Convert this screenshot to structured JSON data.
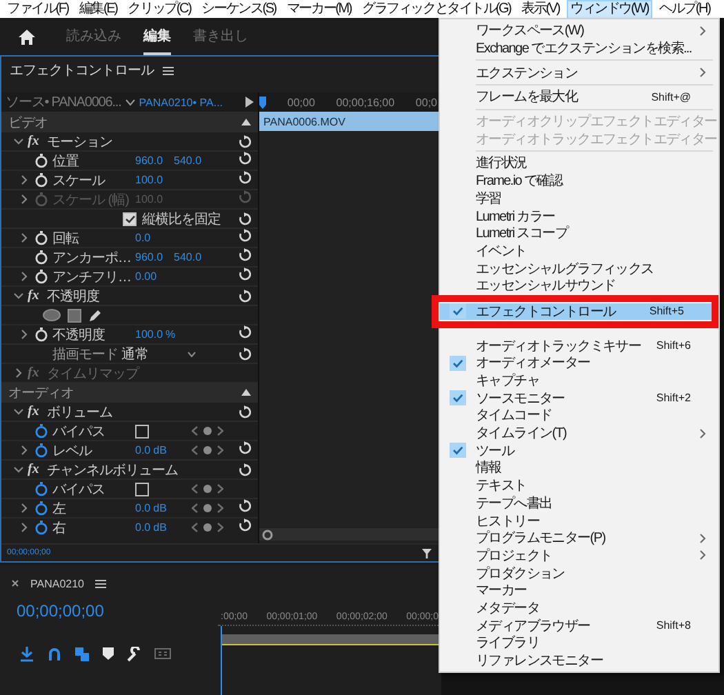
{
  "menu_bar": [
    {
      "label": "ファイル(F)",
      "selected": false
    },
    {
      "label": "編集(E)",
      "selected": false
    },
    {
      "label": "クリップ(C)",
      "selected": false
    },
    {
      "label": "シーケンス(S)",
      "selected": false
    },
    {
      "label": "マーカー(M)",
      "selected": false
    },
    {
      "label": "グラフィックとタイトル(G)",
      "selected": false
    },
    {
      "label": "表示(V)",
      "selected": false
    },
    {
      "label": "ウィンドウ(W)",
      "selected": true
    },
    {
      "label": "ヘルプ(H)",
      "selected": false
    }
  ],
  "workspace_tabs": [
    {
      "label": "読み込み",
      "selected": false
    },
    {
      "label": "編集",
      "selected": true
    },
    {
      "label": "書き出し",
      "selected": false
    }
  ],
  "effect_controls": {
    "title": "エフェクトコントロール",
    "source": "ソース• PANA0006...",
    "sequence": "PANA0210• PA...",
    "ruler": [
      "00;00",
      "00;00;16;00",
      "00;0"
    ],
    "clip": "PANA0006.MOV",
    "timecode": "00;00;00;00",
    "rows": [
      {
        "kind": "section",
        "label": "ビデオ"
      },
      {
        "kind": "effect",
        "badge": "fx",
        "label": "モーション",
        "expanded": true,
        "reset": true
      },
      {
        "kind": "param",
        "label": "位置",
        "values": [
          "960.0",
          "540.0"
        ],
        "expandable": false,
        "disabled": false,
        "animated": false,
        "keyframe_nav": false,
        "reset": true
      },
      {
        "kind": "param",
        "label": "スケール",
        "values": [
          "100.0"
        ],
        "expandable": true,
        "disabled": false,
        "animated": false,
        "keyframe_nav": false,
        "reset": true
      },
      {
        "kind": "param",
        "label": "スケール (幅)",
        "values": [
          "100.0"
        ],
        "expandable": true,
        "disabled": true,
        "animated": false,
        "keyframe_nav": false,
        "reset": true
      },
      {
        "kind": "option",
        "label": "縦横比を固定",
        "checked": true,
        "reset": true
      },
      {
        "kind": "param",
        "label": "回転",
        "values": [
          "0.0"
        ],
        "expandable": true,
        "disabled": false,
        "animated": false,
        "keyframe_nav": false,
        "reset": true
      },
      {
        "kind": "param",
        "label": "アンカーポ…",
        "values": [
          "960.0",
          "540.0"
        ],
        "expandable": false,
        "disabled": false,
        "animated": false,
        "keyframe_nav": false,
        "reset": true
      },
      {
        "kind": "param",
        "label": "アンチフリ…",
        "values": [
          "0.00"
        ],
        "expandable": true,
        "disabled": false,
        "animated": false,
        "keyframe_nav": false,
        "reset": true
      },
      {
        "kind": "effect",
        "badge": "fx",
        "label": "不透明度",
        "expanded": true,
        "reset": true
      },
      {
        "kind": "masks"
      },
      {
        "kind": "param",
        "label": "不透明度",
        "values": [
          "100.0"
        ],
        "unit": "%",
        "expandable": true,
        "disabled": false,
        "animated": false,
        "keyframe_nav": false,
        "reset": true
      },
      {
        "kind": "dropdown",
        "label": "描画モード",
        "value": "通常",
        "reset": true
      },
      {
        "kind": "effect",
        "badge": "fx",
        "label": "タイムリマップ",
        "expanded": false,
        "reset": false
      },
      {
        "kind": "section",
        "label": "オーディオ"
      },
      {
        "kind": "effect",
        "badge": "fx",
        "label": "ボリューム",
        "expanded": true,
        "reset": true
      },
      {
        "kind": "toggle",
        "label": "バイパス",
        "checked": false,
        "animated": true,
        "keyframe_nav": true
      },
      {
        "kind": "param",
        "label": "レベル",
        "values": [
          "0.0"
        ],
        "unit": "dB",
        "expandable": true,
        "disabled": false,
        "animated": true,
        "keyframe_nav": true,
        "reset": true
      },
      {
        "kind": "effect",
        "badge": "fx",
        "label": "チャンネルボリューム",
        "expanded": true,
        "reset": true
      },
      {
        "kind": "toggle",
        "label": "バイパス",
        "checked": false,
        "animated": true,
        "keyframe_nav": true
      },
      {
        "kind": "param",
        "label": "左",
        "values": [
          "0.0"
        ],
        "unit": "dB",
        "expandable": true,
        "disabled": false,
        "animated": true,
        "keyframe_nav": true,
        "reset": true
      },
      {
        "kind": "param",
        "label": "右",
        "values": [
          "0.0"
        ],
        "unit": "dB",
        "expandable": true,
        "disabled": false,
        "animated": true,
        "keyframe_nav": true,
        "reset": true
      }
    ]
  },
  "timeline": {
    "title": "PANA0210",
    "timecode": "00;00;00;00",
    "ruler": [
      ":00;00",
      "00;00;01;00",
      "00;00;02;00",
      "00;00;0"
    ]
  },
  "window_menu": [
    {
      "kind": "item",
      "label": "ワークスペース(W)",
      "submenu": true,
      "checked": false,
      "disabled": false,
      "selected": false,
      "framed": false
    },
    {
      "kind": "item",
      "label": "Exchange でエクステンションを検索...",
      "submenu": false,
      "checked": false,
      "disabled": false,
      "selected": false,
      "framed": false
    },
    {
      "kind": "separator"
    },
    {
      "kind": "item",
      "label": "エクステンション",
      "submenu": true,
      "checked": false,
      "disabled": false,
      "selected": false,
      "framed": false
    },
    {
      "kind": "separator"
    },
    {
      "kind": "item",
      "label": "フレームを最大化",
      "shortcut": "Shift+@",
      "submenu": false,
      "checked": false,
      "disabled": false,
      "selected": false,
      "framed": false
    },
    {
      "kind": "separator"
    },
    {
      "kind": "item",
      "label": "オーディオクリップエフェクトエディター",
      "submenu": false,
      "checked": false,
      "disabled": true,
      "selected": false,
      "framed": false
    },
    {
      "kind": "item",
      "label": "オーディオトラックエフェクトエディター",
      "submenu": false,
      "checked": false,
      "disabled": true,
      "selected": false,
      "framed": false
    },
    {
      "kind": "separator"
    },
    {
      "kind": "item",
      "label": "進行状況",
      "submenu": false,
      "checked": false,
      "disabled": false,
      "selected": false,
      "framed": false
    },
    {
      "kind": "item",
      "label": "Frame.io で確認",
      "submenu": false,
      "checked": false,
      "disabled": false,
      "selected": false,
      "framed": false
    },
    {
      "kind": "item",
      "label": "学習",
      "submenu": false,
      "checked": false,
      "disabled": false,
      "selected": false,
      "framed": false
    },
    {
      "kind": "item",
      "label": "Lumetri カラー",
      "submenu": false,
      "checked": false,
      "disabled": false,
      "selected": false,
      "framed": false
    },
    {
      "kind": "item",
      "label": "Lumetri スコープ",
      "submenu": false,
      "checked": false,
      "disabled": false,
      "selected": false,
      "framed": false
    },
    {
      "kind": "item",
      "label": "イベント",
      "submenu": false,
      "checked": false,
      "disabled": false,
      "selected": false,
      "framed": false
    },
    {
      "kind": "item",
      "label": "エッセンシャルグラフィックス",
      "submenu": false,
      "checked": false,
      "disabled": false,
      "selected": false,
      "framed": false
    },
    {
      "kind": "item",
      "label": "エッセンシャルサウンド",
      "submenu": false,
      "checked": false,
      "disabled": false,
      "selected": false,
      "framed": false
    },
    {
      "kind": "item",
      "label": "エフェクトコントロール",
      "shortcut": "Shift+5",
      "submenu": false,
      "checked": true,
      "disabled": false,
      "selected": true,
      "framed": true
    },
    {
      "kind": "item",
      "label": "オーディオトラックミキサー",
      "shortcut": "Shift+6",
      "submenu": false,
      "checked": false,
      "disabled": false,
      "selected": false,
      "framed": false
    },
    {
      "kind": "item",
      "label": "オーディオメーター",
      "submenu": false,
      "checked": true,
      "disabled": false,
      "selected": false,
      "framed": false
    },
    {
      "kind": "item",
      "label": "キャプチャ",
      "submenu": false,
      "checked": false,
      "disabled": false,
      "selected": false,
      "framed": false
    },
    {
      "kind": "item",
      "label": "ソースモニター",
      "shortcut": "Shift+2",
      "submenu": false,
      "checked": true,
      "disabled": false,
      "selected": false,
      "framed": false
    },
    {
      "kind": "item",
      "label": "タイムコード",
      "submenu": false,
      "checked": false,
      "disabled": false,
      "selected": false,
      "framed": false
    },
    {
      "kind": "item",
      "label": "タイムライン(T)",
      "submenu": true,
      "checked": false,
      "disabled": false,
      "selected": false,
      "framed": false
    },
    {
      "kind": "item",
      "label": "ツール",
      "submenu": false,
      "checked": true,
      "disabled": false,
      "selected": false,
      "framed": false
    },
    {
      "kind": "item",
      "label": "情報",
      "submenu": false,
      "checked": false,
      "disabled": false,
      "selected": false,
      "framed": false
    },
    {
      "kind": "item",
      "label": "テキスト",
      "submenu": false,
      "checked": false,
      "disabled": false,
      "selected": false,
      "framed": false
    },
    {
      "kind": "item",
      "label": "テープへ書出",
      "submenu": false,
      "checked": false,
      "disabled": false,
      "selected": false,
      "framed": false
    },
    {
      "kind": "item",
      "label": "ヒストリー",
      "submenu": false,
      "checked": false,
      "disabled": false,
      "selected": false,
      "framed": false
    },
    {
      "kind": "item",
      "label": "プログラムモニター(P)",
      "submenu": true,
      "checked": false,
      "disabled": false,
      "selected": false,
      "framed": false
    },
    {
      "kind": "item",
      "label": "プロジェクト",
      "submenu": true,
      "checked": false,
      "disabled": false,
      "selected": false,
      "framed": false
    },
    {
      "kind": "item",
      "label": "プロダクション",
      "submenu": false,
      "checked": false,
      "disabled": false,
      "selected": false,
      "framed": false
    },
    {
      "kind": "item",
      "label": "マーカー",
      "submenu": false,
      "checked": false,
      "disabled": false,
      "selected": false,
      "framed": false
    },
    {
      "kind": "item",
      "label": "メタデータ",
      "submenu": false,
      "checked": false,
      "disabled": false,
      "selected": false,
      "framed": false
    },
    {
      "kind": "item",
      "label": "メディアブラウザー",
      "shortcut": "Shift+8",
      "submenu": false,
      "checked": false,
      "disabled": false,
      "selected": false,
      "framed": false
    },
    {
      "kind": "item",
      "label": "ライブラリ",
      "submenu": false,
      "checked": false,
      "disabled": false,
      "selected": false,
      "framed": false
    },
    {
      "kind": "item",
      "label": "リファレンスモニター",
      "submenu": false,
      "checked": false,
      "disabled": false,
      "selected": false,
      "framed": false
    }
  ]
}
